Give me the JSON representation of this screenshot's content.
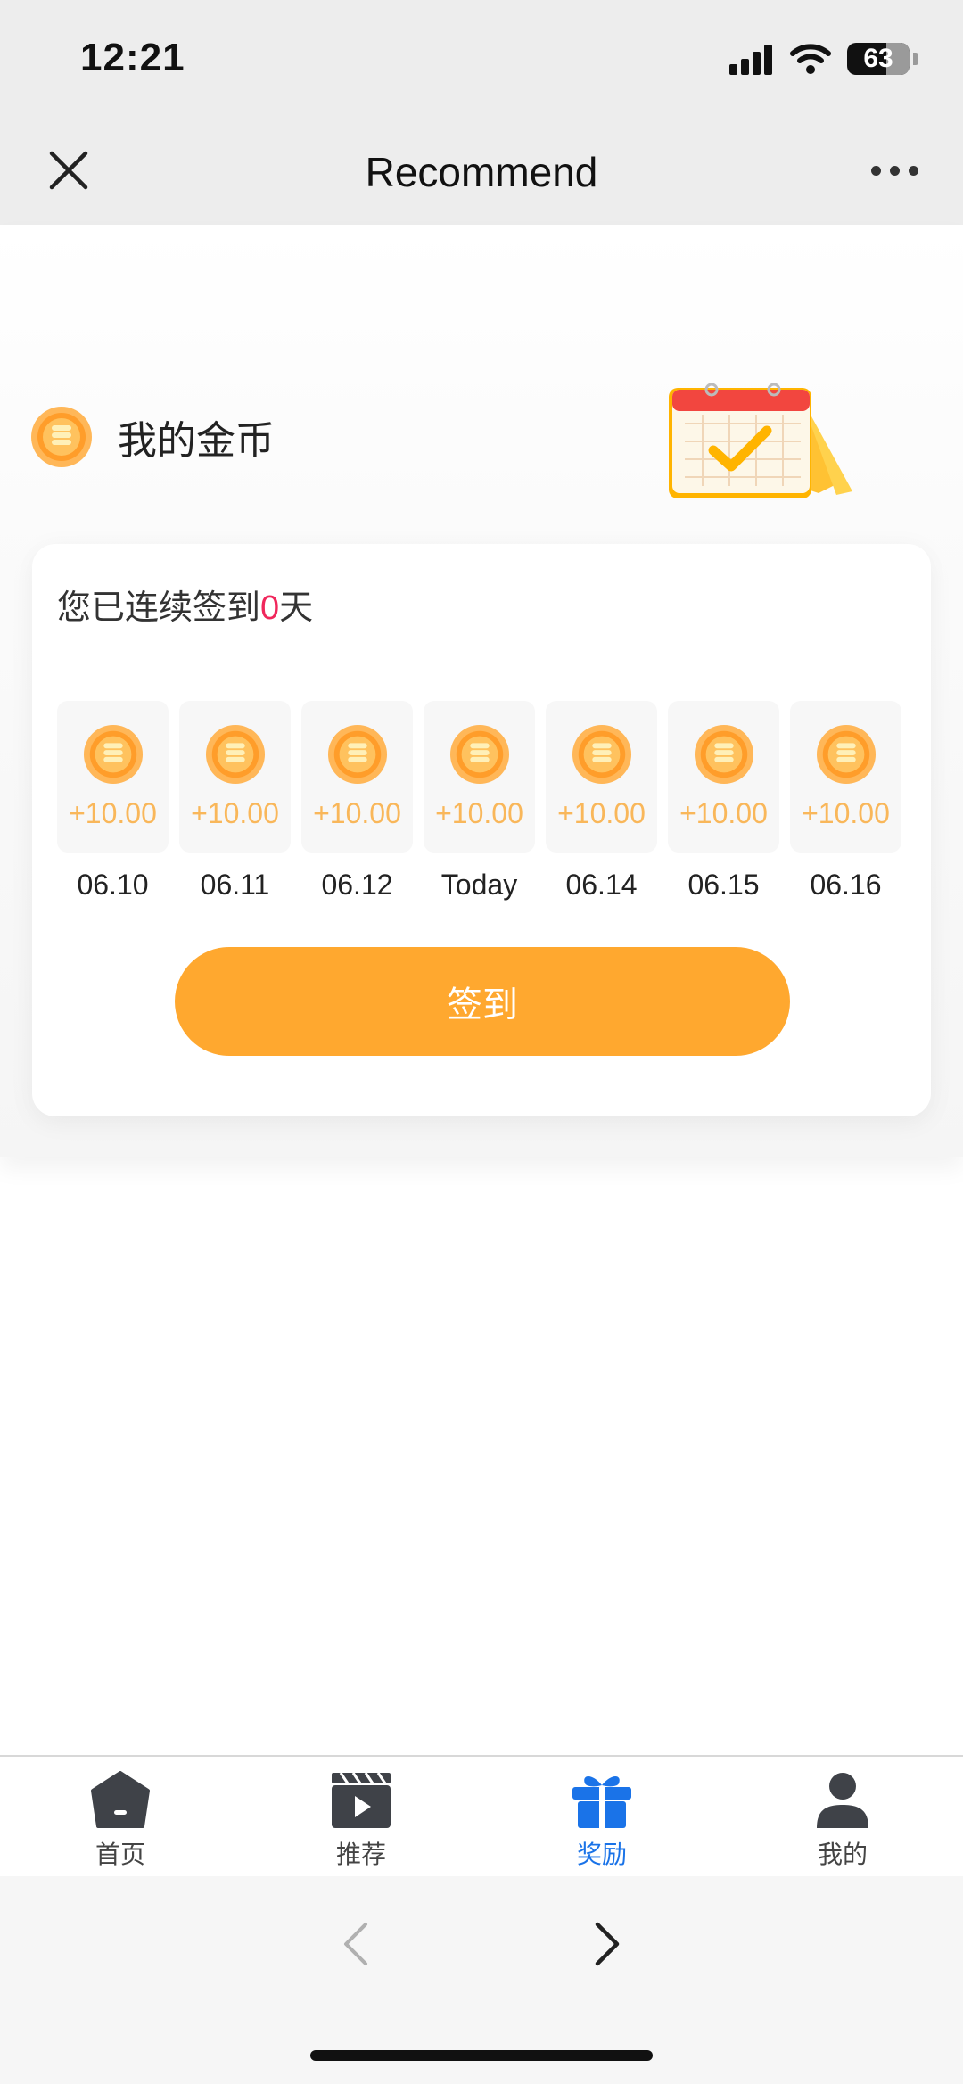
{
  "status_bar": {
    "time": "12:21",
    "battery": "63"
  },
  "nav": {
    "title": "Recommend"
  },
  "coins": {
    "title": "我的金币"
  },
  "streak": {
    "prefix": "您已连续签到",
    "count": "0",
    "suffix": "天"
  },
  "days": [
    {
      "reward": "+10.00",
      "label": "06.10"
    },
    {
      "reward": "+10.00",
      "label": "06.11"
    },
    {
      "reward": "+10.00",
      "label": "06.12"
    },
    {
      "reward": "+10.00",
      "label": "Today"
    },
    {
      "reward": "+10.00",
      "label": "06.14"
    },
    {
      "reward": "+10.00",
      "label": "06.15"
    },
    {
      "reward": "+10.00",
      "label": "06.16"
    }
  ],
  "signin_button": "签到",
  "tabs": [
    {
      "label": "首页",
      "icon": "home-icon"
    },
    {
      "label": "推荐",
      "icon": "video-icon"
    },
    {
      "label": "奖励",
      "icon": "gift-icon",
      "active": true
    },
    {
      "label": "我的",
      "icon": "profile-icon"
    }
  ],
  "colors": {
    "accent": "#ffa82f",
    "active_tab": "#1a73e8",
    "streak_number": "#f0265b",
    "reward_text": "#f9b75a"
  }
}
